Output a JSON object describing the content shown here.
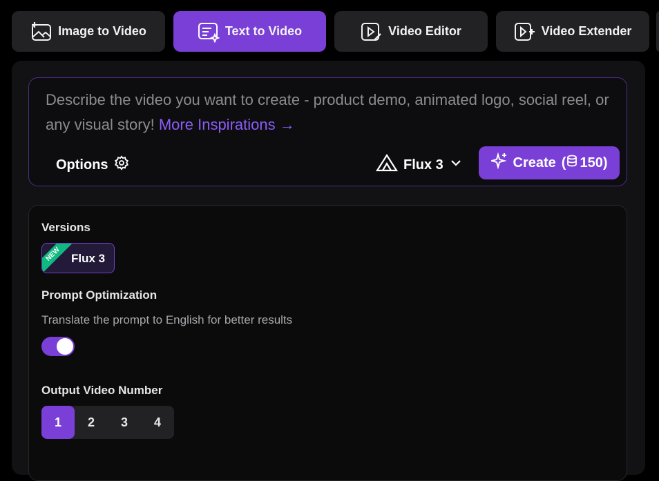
{
  "tabs": [
    {
      "label": "Image to Video",
      "icon": "image-plus-icon",
      "active": false
    },
    {
      "label": "Text to Video",
      "icon": "text-sparkle-icon",
      "active": true
    },
    {
      "label": "Video Editor",
      "icon": "video-edit-icon",
      "active": false
    },
    {
      "label": "Video Extender",
      "icon": "video-extend-icon",
      "active": false
    }
  ],
  "prompt": {
    "placeholder": "Describe the video you want to create - product demo, animated logo, social reel, or any visual story!",
    "link": "More Inspirations →"
  },
  "toolbar": {
    "options_label": "Options",
    "model_label": "Flux 3",
    "create_label": "Create",
    "create_cost": "(",
    "create_cost_value": "150)"
  },
  "settings": {
    "versions_label": "Versions",
    "version_chip": "Flux 3",
    "version_badge": "NEW",
    "prompt_opt_label": "Prompt Optimization",
    "prompt_opt_desc": "Translate the prompt to English for better results",
    "prompt_opt_enabled": true,
    "output_label": "Output Video Number",
    "output_options": [
      "1",
      "2",
      "3",
      "4"
    ],
    "output_selected": "1"
  },
  "colors": {
    "accent": "#7a3fd6",
    "link": "#8b5cf6",
    "badge": "#10b981",
    "background": "#000000",
    "panel": "#121214"
  }
}
